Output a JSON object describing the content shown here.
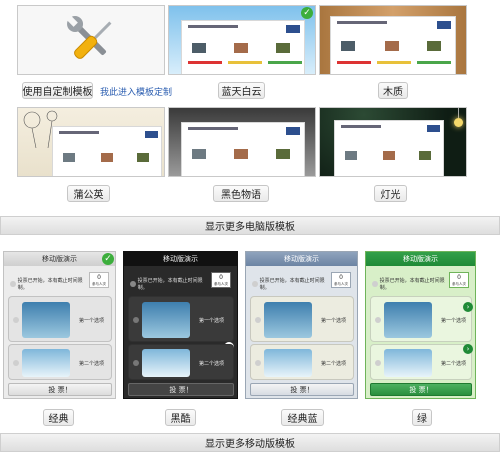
{
  "pc_templates": {
    "custom": {
      "button": "使用自定制模板",
      "link": "我此进入模板定制",
      "icon": "tools-icon"
    },
    "items": [
      {
        "label": "蓝天白云",
        "selected": true
      },
      {
        "label": "木质"
      },
      {
        "label": "蒲公英"
      },
      {
        "label": "黑色物语"
      },
      {
        "label": "灯光"
      }
    ],
    "more_button": "显示更多电脑版模板"
  },
  "mobile_preview": {
    "header": "移动版演示",
    "notice": "投票已开始，本有截止时间限制。",
    "count": "0",
    "count_label": "参与人次",
    "option1": "第一个选项",
    "option2": "第二个选项",
    "vote_button": "投 票！"
  },
  "mobile_templates": {
    "items": [
      {
        "label": "经典",
        "selected": true
      },
      {
        "label": "黑酷"
      },
      {
        "label": "经典蓝"
      },
      {
        "label": "绿"
      }
    ],
    "more_button": "显示更多移动版模板"
  },
  "colors": {
    "accent_green": "#3cae3c",
    "link_blue": "#2a5db0"
  }
}
